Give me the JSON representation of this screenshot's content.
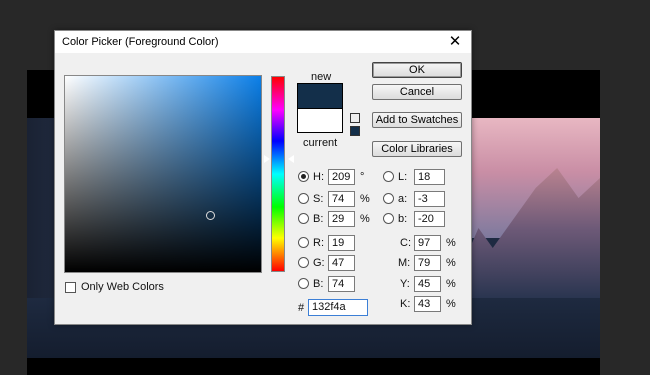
{
  "dialog": {
    "title": "Color Picker (Foreground Color)",
    "close_glyph": "✕"
  },
  "colors": {
    "new": "#132f4a",
    "current": "#ffffff",
    "hue_accent": "#0b7fe8"
  },
  "labels": {
    "new": "new",
    "current": "current",
    "only_web_colors": "Only Web Colors",
    "hex_prefix": "#"
  },
  "buttons": {
    "ok": "OK",
    "cancel": "Cancel",
    "add_to_swatches": "Add to Swatches",
    "color_libraries": "Color Libraries"
  },
  "hsb": {
    "h": {
      "label": "H:",
      "value": "209",
      "unit": "°"
    },
    "s": {
      "label": "S:",
      "value": "74",
      "unit": "%"
    },
    "b": {
      "label": "B:",
      "value": "29",
      "unit": "%"
    }
  },
  "rgb": {
    "r": {
      "label": "R:",
      "value": "19"
    },
    "g": {
      "label": "G:",
      "value": "47"
    },
    "b": {
      "label": "B:",
      "value": "74"
    }
  },
  "lab": {
    "l": {
      "label": "L:",
      "value": "18"
    },
    "a": {
      "label": "a:",
      "value": "-3"
    },
    "b": {
      "label": "b:",
      "value": "-20"
    }
  },
  "cmyk": {
    "c": {
      "label": "C:",
      "value": "97",
      "unit": "%"
    },
    "m": {
      "label": "M:",
      "value": "79",
      "unit": "%"
    },
    "y": {
      "label": "Y:",
      "value": "45",
      "unit": "%"
    },
    "k": {
      "label": "K:",
      "value": "43",
      "unit": "%"
    }
  },
  "hex": "132f4a",
  "icons": {
    "gamut_warning": "cube-icon",
    "websafe_warning": "websafe-square-icon"
  }
}
